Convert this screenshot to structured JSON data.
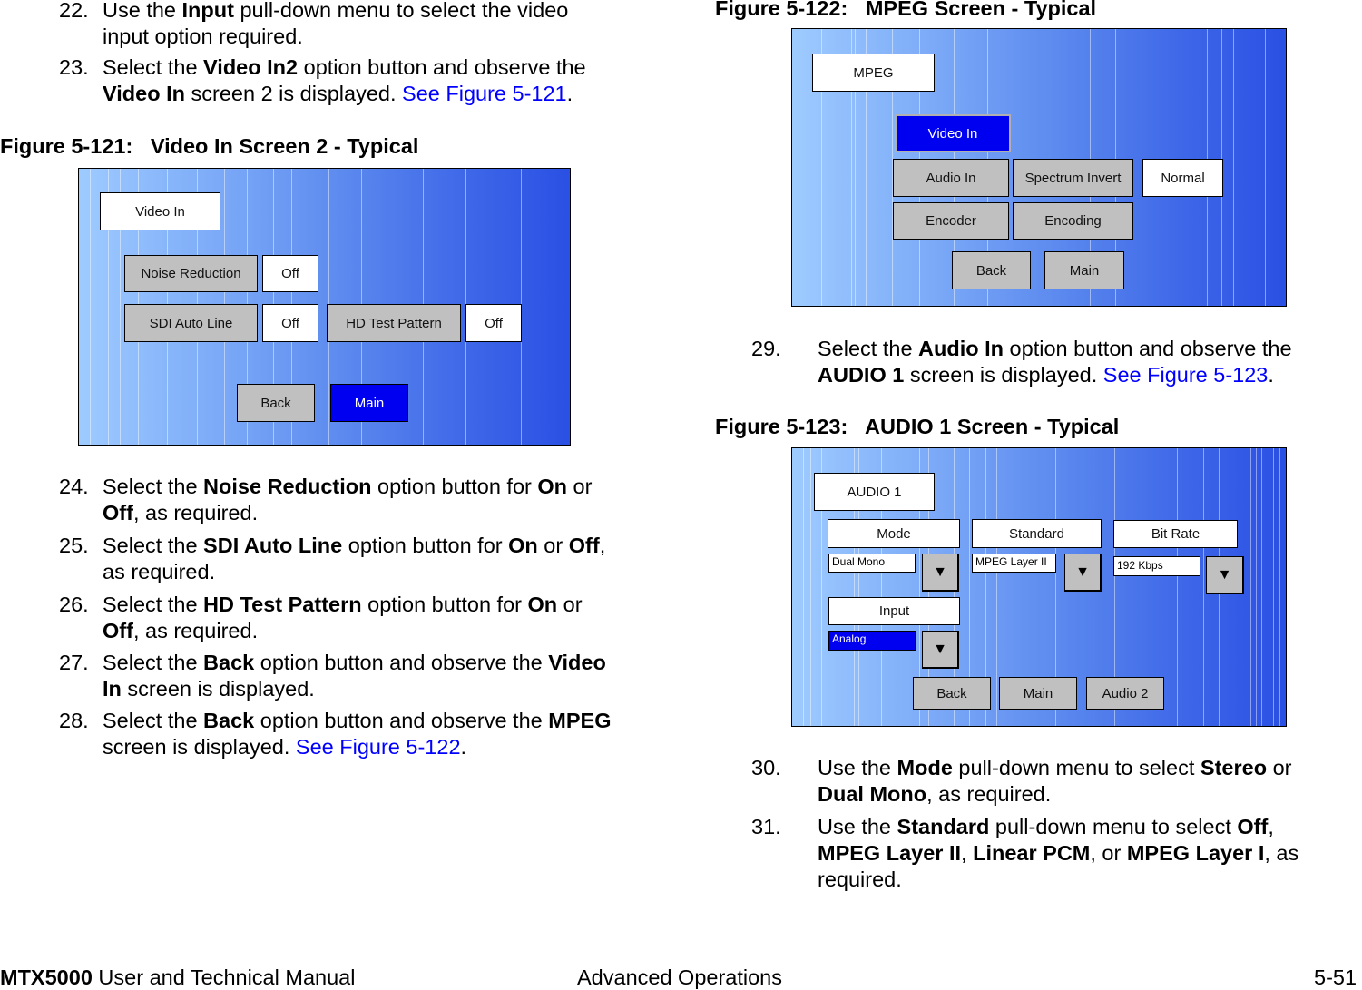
{
  "left_column": {
    "step22": {
      "num": "22.",
      "pre": "Use the ",
      "b1": "Input",
      "post": " pull-down menu to select the video",
      "line2": "input option required."
    },
    "step23": {
      "num": "23.",
      "pre": "Select the ",
      "b1": "Video In2",
      "post": " option button and observe the",
      "b2": "Video In",
      "mid2": " screen 2 is displayed.  ",
      "link": "See Figure 5-121",
      "end": "."
    },
    "figure121": {
      "title": "Figure 5-121:   Video In Screen 2 - Typical",
      "screen_title": "Video In",
      "noise_reduction_label": "Noise Reduction",
      "noise_reduction_value": "Off",
      "sdi_auto_line_label": "SDI Auto Line",
      "sdi_auto_line_value": "Off",
      "hd_test_pattern_label": "HD Test Pattern",
      "hd_test_pattern_value": "Off",
      "back_label": "Back",
      "main_label": "Main"
    },
    "step24": {
      "num": "24.",
      "pre": "Select the ",
      "b1": "Noise Reduction",
      "mid": " option button for ",
      "b2": "On",
      "or": " or",
      "b3": "Off",
      "end": ", as required."
    },
    "step25": {
      "num": "25.",
      "pre": "Select the ",
      "b1": "SDI Auto Line",
      "mid": " option button for ",
      "b2": "On",
      "or": " or ",
      "b3": "Off",
      "comma": ",",
      "line2": "as required."
    },
    "step26": {
      "num": "26.",
      "pre": "Select the ",
      "b1": "HD Test Pattern",
      "mid": " option button for ",
      "b2": "On",
      "or": " or",
      "b3": "Off",
      "end": ", as required."
    },
    "step27": {
      "num": "27.",
      "pre": "Select the ",
      "b1": "Back",
      "mid": " option button and observe the ",
      "b2": "Video",
      "b3": "In",
      "end": " screen is displayed."
    },
    "step28": {
      "num": "28.",
      "pre": "Select the ",
      "b1": "Back",
      "mid": " option button and observe the ",
      "b2": "MPEG",
      "line2": "screen is displayed.  ",
      "link": "See Figure 5-122",
      "end": "."
    }
  },
  "right_column": {
    "figure122": {
      "title": "Figure 5-122:   MPEG Screen - Typical",
      "screen_title": "MPEG",
      "video_in_label": "Video In",
      "audio_in_label": "Audio In",
      "spectrum_invert_label": "Spectrum Invert",
      "spectrum_invert_value": "Normal",
      "encoder_label": "Encoder",
      "encoding_label": "Encoding",
      "back_label": "Back",
      "main_label": "Main"
    },
    "step29": {
      "num": "29.",
      "pre": "Select the ",
      "b1": "Audio In",
      "post": " option button and observe the",
      "b2": "AUDIO 1",
      "mid2": " screen is displayed.  ",
      "link": "See Figure 5-123",
      "end": "."
    },
    "figure123": {
      "title": "Figure 5-123:   AUDIO 1 Screen - Typical",
      "screen_title": "AUDIO 1",
      "mode_label": "Mode",
      "mode_value": "Dual Mono",
      "standard_label": "Standard",
      "standard_value": "MPEG Layer II",
      "bit_rate_label": "Bit Rate",
      "bit_rate_value": "192 Kbps",
      "input_label": "Input",
      "input_value": "Analog",
      "dropdown_glyph": "▼",
      "back_label": "Back",
      "main_label": "Main",
      "audio2_label": "Audio 2"
    },
    "step30": {
      "num": "30.",
      "pre": "Use the ",
      "b1": "Mode",
      "mid": " pull-down menu to select ",
      "b2": "Stereo",
      "or": " or",
      "b3": "Dual Mono",
      "end": ", as required."
    },
    "step31": {
      "num": "31.",
      "pre": "Use the ",
      "b1": "Standard",
      "mid": " pull-down menu to select ",
      "b2": "Off",
      "comma": ",",
      "b3": "MPEG Layer II",
      "c2": ", ",
      "b4": "Linear PCM",
      "or": ", or ",
      "b5": "MPEG Layer I",
      "as": ", as",
      "line3": "required."
    }
  },
  "footer": {
    "product": "MTX5000",
    "manual": " User and Technical Manual",
    "section": "Advanced Operations",
    "page": "5-51"
  },
  "colors": {
    "link": "#0000ff",
    "selected_button": "#0000f0",
    "option_button": "#c0c0c0"
  }
}
